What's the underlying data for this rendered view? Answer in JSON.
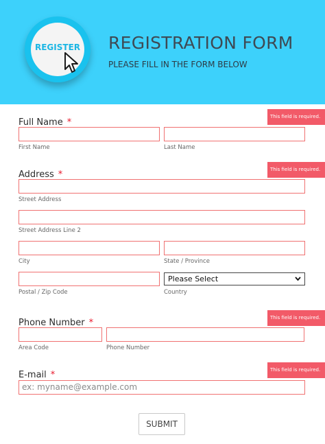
{
  "header": {
    "logo_text": "REGISTER",
    "title": "REGISTRATION FORM",
    "subtitle": "PLEASE FILL IN THE FORM BELOW"
  },
  "errors": {
    "required": "This field is required."
  },
  "full_name": {
    "label": "Full Name",
    "required_mark": "*",
    "first_sub": "First Name",
    "last_sub": "Last Name"
  },
  "address": {
    "label": "Address",
    "required_mark": "*",
    "street_sub": "Street Address",
    "street2_sub": "Street Address Line 2",
    "city_sub": "City",
    "state_sub": "State / Province",
    "postal_sub": "Postal / Zip Code",
    "country_sub": "Country",
    "country_selected": "Please Select"
  },
  "phone": {
    "label": "Phone Number",
    "required_mark": "*",
    "area_sub": "Area Code",
    "number_sub": "Phone Number"
  },
  "email": {
    "label": "E-mail",
    "required_mark": "*",
    "placeholder": "ex: myname@example.com"
  },
  "submit_label": "SUBMIT",
  "colors": {
    "header_bg": "#3dd1fb",
    "error_bg": "#f25a68",
    "field_border": "#f07070",
    "required_mark": "#e8172a"
  }
}
